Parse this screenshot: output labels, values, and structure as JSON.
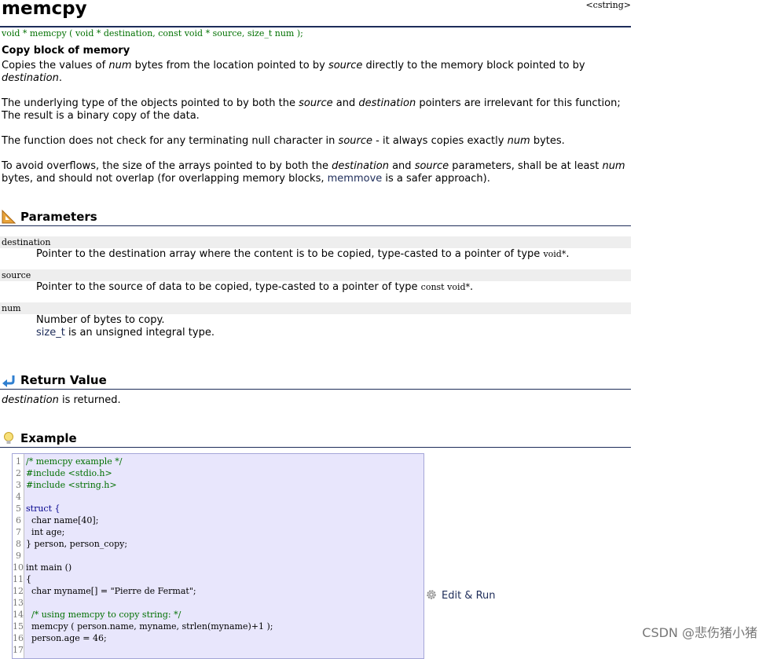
{
  "page": {
    "title": "memcpy",
    "header_tag": "<cstring>",
    "prototype": "void * memcpy ( void * destination, const void * source, size_t num );",
    "subtitle": "Copy block of memory"
  },
  "description": {
    "p1": {
      "a": "Copies the values of ",
      "b": "num",
      "c": " bytes from the location pointed to by ",
      "d": "source",
      "e": " directly to the memory block pointed to by ",
      "f": "destination",
      "g": "."
    },
    "p2": {
      "a": "The underlying type of the objects pointed to by both the ",
      "b": "source",
      "c": " and ",
      "d": "destination",
      "e": " pointers are irrelevant for this function; The result is a binary copy of the data."
    },
    "p3": {
      "a": "The function does not check for any terminating null character in ",
      "b": "source",
      "c": " - it always copies exactly ",
      "d": "num",
      "e": " bytes."
    },
    "p4": {
      "a": "To avoid overflows, the size of the arrays pointed to by both the ",
      "b": "destination",
      "c": " and ",
      "d": "source",
      "e": " parameters, shall be at least ",
      "f": "num",
      "g": " bytes, and should not overlap (for overlapping memory blocks, ",
      "h": "memmove",
      "i": " is a safer approach)."
    }
  },
  "sections": {
    "parameters": "Parameters",
    "return_value": "Return Value",
    "example": "Example"
  },
  "params": [
    {
      "name": "destination",
      "text": "Pointer to the destination array where the content is to be copied, type-casted to a pointer of type ",
      "code": "void*",
      "end": "."
    },
    {
      "name": "source",
      "text": "Pointer to the source of data to be copied, type-casted to a pointer of type ",
      "code": "const void*",
      "end": "."
    },
    {
      "name": "num",
      "line1": "Number of bytes to copy.",
      "link": "size_t",
      "line2": " is an unsigned integral type."
    }
  ],
  "return_value": {
    "em": "destination",
    "rest": " is returned."
  },
  "code_lines": [
    {
      "n": "1",
      "text": "/* memcpy example */",
      "cls": "c-comment"
    },
    {
      "n": "2",
      "text": "#include <stdio.h>",
      "cls": "c-pre"
    },
    {
      "n": "3",
      "text": "#include <string.h>",
      "cls": "c-pre"
    },
    {
      "n": "4",
      "text": "",
      "cls": ""
    },
    {
      "n": "5",
      "text": "struct {",
      "cls": "c-kw"
    },
    {
      "n": "6",
      "text": "  char name[40];",
      "cls": ""
    },
    {
      "n": "7",
      "text": "  int age;",
      "cls": ""
    },
    {
      "n": "8",
      "text": "} person, person_copy;",
      "cls": ""
    },
    {
      "n": "9",
      "text": "",
      "cls": ""
    },
    {
      "n": "10",
      "text": "int main ()",
      "cls": ""
    },
    {
      "n": "11",
      "text": "{",
      "cls": ""
    },
    {
      "n": "12",
      "text": "  char myname[] = \"Pierre de Fermat\";",
      "cls": ""
    },
    {
      "n": "13",
      "text": "",
      "cls": ""
    },
    {
      "n": "14",
      "text": "  /* using memcpy to copy string: */",
      "cls": "c-comment"
    },
    {
      "n": "15",
      "text": "  memcpy ( person.name, myname, strlen(myname)+1 );",
      "cls": ""
    },
    {
      "n": "16",
      "text": "  person.age = 46;",
      "cls": ""
    },
    {
      "n": "17",
      "text": "",
      "cls": ""
    }
  ],
  "edit_run": "Edit & Run",
  "watermark": "CSDN @悲伤猪小猪",
  "icons": {
    "parameters": "ruler-triangle-icon",
    "return_value": "return-arrow-icon",
    "example": "lightbulb-icon",
    "edit_run": "gear-icon"
  },
  "colors": {
    "accent": "#1d2c59",
    "prototype": "#007000",
    "code_bg": "#e8e6fc",
    "param_bg": "#eeeeee"
  }
}
